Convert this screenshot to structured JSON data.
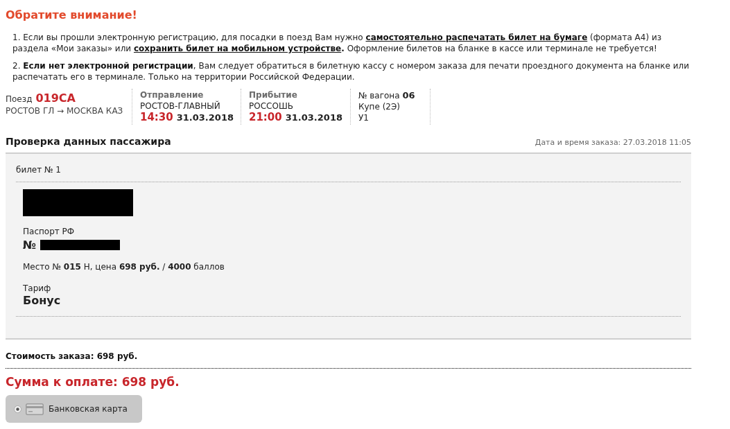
{
  "notice": {
    "title": "Обратите внимание!",
    "items": [
      {
        "segments": [
          {
            "kind": "text",
            "text": "1. Если вы прошли электронную регистрацию, для посадки в поезд Вам нужно "
          },
          {
            "kind": "link",
            "text": "самостоятельно распечатать билет на бумаге"
          },
          {
            "kind": "text",
            "text": " (формата А4) из раздела «Мои заказы» или "
          },
          {
            "kind": "link",
            "text": "сохранить билет на мобильном устройстве"
          },
          {
            "kind": "text",
            "text": "**.** Оформление билетов на бланке в кассе или терминале не требуется!"
          }
        ]
      },
      {
        "segments": [
          {
            "kind": "text",
            "text": "2. **Если нет электронной регистрации**, Вам следует обратиться в билетную кассу с номером заказа для печати проездного документа на бланке или распечатать его в терминале. Только на территории Российской Федерации."
          }
        ]
      }
    ]
  },
  "trip": {
    "train": {
      "label": "Поезд",
      "number": "019СА",
      "route": "РОСТОВ ГЛ → МОСКВА КАЗ"
    },
    "stops": [
      {
        "heading": "Отправление",
        "station": "РОСТОВ-ГЛАВНЫЙ",
        "time": "14:30",
        "date": "31.03.2018"
      },
      {
        "heading": "Прибытие",
        "station": "РОССОШЬ",
        "time": "21:00",
        "date": "31.03.2018"
      }
    ],
    "car": {
      "number": "№ вагона **06**",
      "class": "Купе (2Э)",
      "seat_type": "У1"
    }
  },
  "passenger_check": {
    "title": "Проверка данных пассажира",
    "order_date": "Дата и время заказа: 27.03.2018 11:05",
    "tickets": [
      {
        "label": "билет № 1",
        "name_redacted": true,
        "document_type": "Паспорт РФ",
        "document_number_sign": "№",
        "document_number_redacted": true,
        "seat_price": "Место № **015** Н, цена **698 руб.** / **4000** баллов",
        "tariff_label": "Тариф",
        "tariff": "Бонус"
      }
    ]
  },
  "summary": {
    "order_cost": "Стоимость заказа: 698 руб.",
    "total_due": "Сумма к оплате: 698 руб."
  },
  "payment_methods": [
    {
      "label": "Банковская карта",
      "selected": true
    }
  ]
}
